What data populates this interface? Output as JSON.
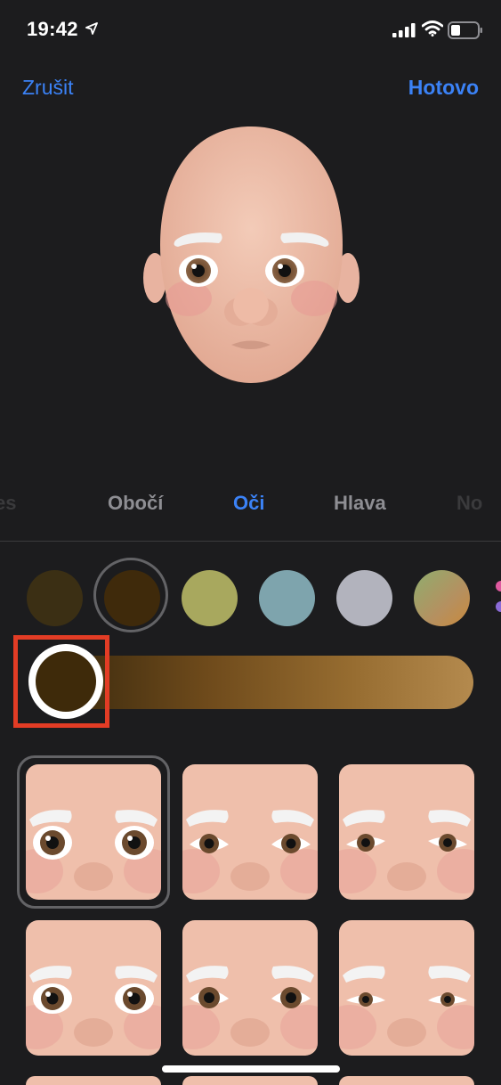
{
  "status": {
    "time": "19:42"
  },
  "nav": {
    "cancel": "Zrušit",
    "done": "Hotovo"
  },
  "tabs": [
    "es",
    "Obočí",
    "Oči",
    "Hlava",
    "No"
  ],
  "active_tab": "Oči",
  "eye_colors": [
    "#3b2f14",
    "#3f2a0b",
    "#a8a85e",
    "#7ea4ad",
    "#b2b3bd",
    "gradient-green-orange"
  ],
  "selected_eye_color_index": 1,
  "slider": {
    "knob_color": "#3e2a0a"
  },
  "highlight_color": "#e23c25",
  "eye_shape_selected_index": 0
}
